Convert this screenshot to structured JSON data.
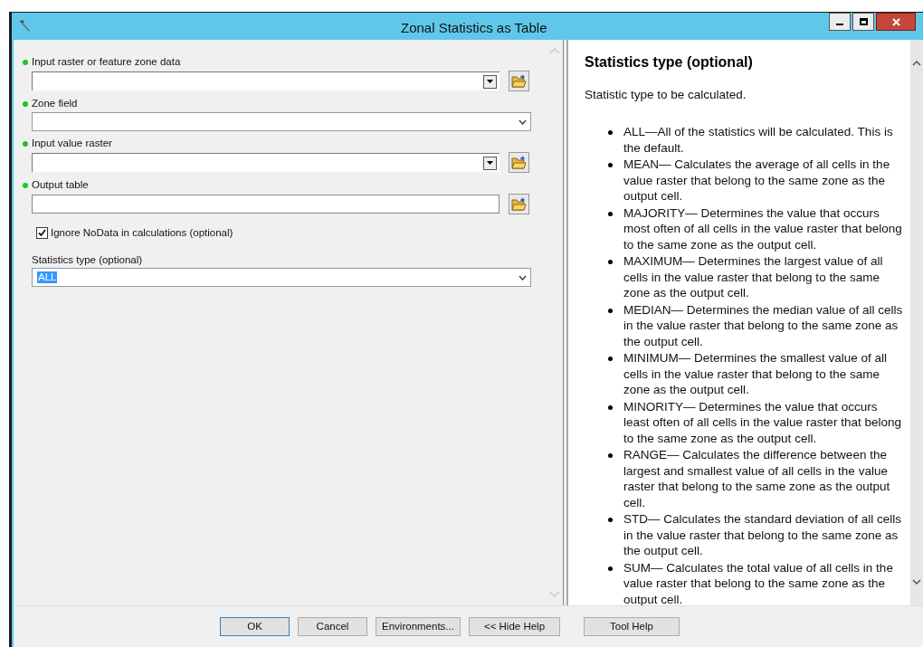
{
  "window": {
    "title": "Zonal Statistics as Table"
  },
  "parameters": [
    {
      "kind": "combo-browse",
      "label": "Input raster or feature zone data",
      "required": true
    },
    {
      "kind": "dropdown",
      "label": "Zone field",
      "required": true
    },
    {
      "kind": "combo-browse",
      "label": "Input value raster",
      "required": true
    },
    {
      "kind": "text-browse",
      "label": "Output table",
      "required": true
    },
    {
      "kind": "checkbox",
      "label": "Ignore NoData in calculations (optional)",
      "checked": true
    },
    {
      "kind": "dropdown",
      "label": "Statistics type (optional)",
      "required": false,
      "value": "ALL",
      "highlighted": true
    }
  ],
  "help": {
    "title": "Statistics type (optional)",
    "intro": "Statistic type to be calculated.",
    "items": [
      "ALL—All of the statistics will be calculated. This is the default.",
      "MEAN— Calculates the average of all cells in the value raster that belong to the same zone as the output cell.",
      "MAJORITY— Determines the value that occurs most often of all cells in the value raster that belong to the same zone as the output cell.",
      "MAXIMUM— Determines the largest value of all cells in the value raster that belong to the same zone as the output cell.",
      "MEDIAN— Determines the median value of all cells in the value raster that belong to the same zone as the output cell.",
      "MINIMUM— Determines the smallest value of all cells in the value raster that belong to the same zone as the output cell.",
      "MINORITY— Determines the value that occurs least often of all cells in the value raster that belong to the same zone as the output cell.",
      "RANGE— Calculates the difference between the largest and smallest value of all cells in the value raster that belong to the same zone as the output cell.",
      "STD— Calculates the standard deviation of all cells in the value raster that belong to the same zone as the output cell.",
      "SUM— Calculates the total value of all cells in the value raster that belong to the same zone as the output cell."
    ]
  },
  "buttons": [
    {
      "label": "OK",
      "default": true
    },
    {
      "label": "Cancel",
      "default": false
    },
    {
      "label": "Environments...",
      "default": false
    },
    {
      "label": "<< Hide Help",
      "default": false
    },
    {
      "label": "Tool Help",
      "default": false
    }
  ]
}
